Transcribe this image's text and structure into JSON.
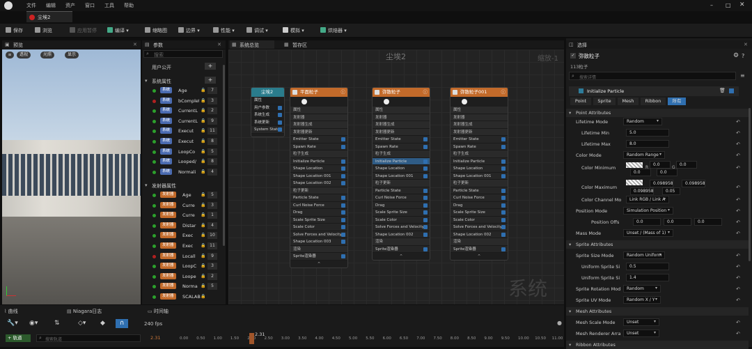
{
  "menu": [
    "文件",
    "编辑",
    "资产",
    "窗口",
    "工具",
    "帮助"
  ],
  "doc_tab": "尘埃2",
  "toolbar": {
    "save": "保存",
    "browse": "浏览",
    "apply": "应用暂停",
    "compile": "编译",
    "thumbnail": "缩略图",
    "bounds": "边界",
    "perf": "性能",
    "debug": "调试",
    "sim": "模拟",
    "baker": "烘焙器"
  },
  "preview": {
    "tab": "预览",
    "persp": "透视",
    "lit": "光照",
    "show": "显示"
  },
  "params": {
    "tab": "参数",
    "search": "搜索",
    "user_exposed": "用户公开",
    "system_attrs": "系统属性",
    "emitter_attrs": "发射器属性",
    "system_items": [
      {
        "badge": "系统",
        "name": "Age",
        "count": "7",
        "dot": "#2ca02c"
      },
      {
        "badge": "系统",
        "name": "bComplet",
        "count": "3",
        "dot": "#b02020"
      },
      {
        "badge": "系统",
        "name": "CurrentL",
        "count": "2",
        "dot": "#2ca02c"
      },
      {
        "badge": "系统",
        "name": "CurrentL",
        "count": "9",
        "dot": "#2ca02c"
      },
      {
        "badge": "系统",
        "name": "Execut",
        "count": "11",
        "dot": "#2ca02c"
      },
      {
        "badge": "系统",
        "name": "Execut",
        "count": "8",
        "dot": "#2ca02c"
      },
      {
        "badge": "系统",
        "name": "LoopCo",
        "count": "5",
        "dot": "#2ca02c"
      },
      {
        "badge": "系统",
        "name": "Looped/",
        "count": "8",
        "dot": "#2ca02c"
      },
      {
        "badge": "系统",
        "name": "Normali",
        "count": "4",
        "dot": "#2ca02c"
      }
    ],
    "emitter_items": [
      {
        "badge": "发射器",
        "name": "Age",
        "count": "5",
        "dot": "#2ca02c"
      },
      {
        "badge": "发射器",
        "name": "Curre",
        "count": "3",
        "dot": "#2ca02c"
      },
      {
        "badge": "发射器",
        "name": "Curre",
        "count": "1",
        "dot": "#2ca02c"
      },
      {
        "badge": "发射器",
        "name": "Distar",
        "count": "4",
        "dot": "#2ca02c"
      },
      {
        "badge": "发射器",
        "name": "Exec",
        "count": "10",
        "dot": "#2ca02c"
      },
      {
        "badge": "发射器",
        "name": "Exec",
        "count": "11",
        "dot": "#2ca02c"
      },
      {
        "badge": "发射器",
        "name": "Locall",
        "count": "9",
        "dot": "#b02020"
      },
      {
        "badge": "发射器",
        "name": "LoopC",
        "count": "3",
        "dot": "#2ca02c"
      },
      {
        "badge": "发射器",
        "name": "Loope",
        "count": "2",
        "dot": "#2ca02c"
      },
      {
        "badge": "发射器",
        "name": "Norma",
        "count": "5",
        "dot": "#2ca02c"
      },
      {
        "badge": "发射器",
        "name": "SCALAB",
        "count": "",
        "dot": "#2ca02c"
      }
    ]
  },
  "graph": {
    "tab1": "系统总览",
    "tab2": "暂存区",
    "title": "尘埃2",
    "watermark": "系统",
    "zoom": "缩放-1",
    "system_node": {
      "title": "尘埃2",
      "rows": [
        "属性",
        "用户参数",
        "系统生成",
        "系统更新",
        "System State"
      ]
    },
    "emitters": [
      {
        "title": "平面粒子",
        "rows": [
          "属性",
          "发射器",
          "发射器生成",
          "发射器更新",
          "Emitter State",
          "Spawn Rate",
          "粒子生成",
          "Initialize Particle",
          "Shape Location",
          "Shape Location 001",
          "Shape Location 002",
          "粒子更新",
          "Particle State",
          "Curl Noise Force",
          "Drag",
          "Scale Sprite Size",
          "Scale Color",
          "Solve Forces and Velocity",
          "Shape Location 003",
          "渲染",
          "Sprite渲染器"
        ]
      },
      {
        "title": "弥散粒子",
        "rows": [
          "属性",
          "发射器",
          "发射器生成",
          "发射器更新",
          "Emitter State",
          "Spawn Rate",
          "粒子生成",
          "Initialize Particle",
          "Shape Location",
          "Shape Location 001",
          "粒子更新",
          "Particle State",
          "Curl Noise Force",
          "Drag",
          "Scale Sprite Size",
          "Scale Color",
          "Solve Forces and Velocity",
          "Shape Location 002",
          "渲染",
          "Sprite渲染器"
        ]
      },
      {
        "title": "弥散粒子001",
        "rows": [
          "属性",
          "发射器",
          "发射器生成",
          "发射器更新",
          "Emitter State",
          "Spawn Rate",
          "粒子生成",
          "Initialize Particle",
          "Shape Location",
          "Shape Location 001",
          "粒子更新",
          "Particle State",
          "Curl Noise Force",
          "Drag",
          "Scale Sprite Size",
          "Scale Color",
          "Solve Forces and Velocity",
          "Shape Location 002",
          "渲染",
          "Sprite渲染器"
        ]
      }
    ]
  },
  "details": {
    "tab": "选择",
    "emitter": "弥散粒子",
    "subtitle": "113粒子",
    "search": "搜索详情",
    "module": "Initialize Particle",
    "filters": [
      "Point",
      "Sprite",
      "Mesh",
      "Ribbon",
      "所有"
    ],
    "sec_point": "Point Attributes",
    "lifetime_mode_label": "Lifetime Mode",
    "lifetime_mode": "Random",
    "lifetime_min_label": "Lifetime Min",
    "lifetime_min": "5.0",
    "lifetime_max_label": "Lifetime Max",
    "lifetime_max": "8.0",
    "color_mode_label": "Color Mode",
    "color_mode": "Random Range",
    "color_min_label": "Color Minimum",
    "cmin_r": "0.0",
    "cmin_g": "0.0",
    "cmin_b": "0.0",
    "cmin_a": "0.0",
    "color_max_label": "Color Maximum",
    "cmax_r": "0.098958",
    "cmax_g": "0.098958",
    "cmax_b": "0.098958",
    "cmax_a": "0.05",
    "channel_label": "Color Channel Mo",
    "channel": "Link RGB / Link A",
    "pos_mode_label": "Position Mode",
    "pos_mode": "Simulation Position",
    "pos_offset_label": "Position Offs",
    "px": "0.0",
    "py": "0.0",
    "pz": "0.0",
    "mass_label": "Mass Mode",
    "mass": "Unset / (Mass of 1)",
    "sec_sprite": "Sprite Attributes",
    "size_mode_label": "Sprite Size Mode",
    "size_mode": "Random Uniform",
    "usize_min_label": "Uniform Sprite Si",
    "usize_min": "0.5",
    "usize_max_label": "Uniform Sprite Si",
    "usize_max": "1.4",
    "rot_label": "Sprite Rotation Mod",
    "rot": "Random",
    "uv_label": "Sprite UV Mode",
    "uv": "Random X / Y",
    "sec_mesh": "Mesh Attributes",
    "mesh_scale_label": "Mesh Scale Mode",
    "mesh_scale": "Unset",
    "mesh_renderer_label": "Mesh Renderer Arra",
    "mesh_renderer": "Unset",
    "sec_ribbon": "Ribbon Attributes"
  },
  "bottom": {
    "tab_curves": "曲线",
    "tab_log": "Niagara日志",
    "tab_timeline": "时间轴",
    "fps": "240 fps",
    "add_track": "轨道",
    "search": "搜索轨道",
    "time": "2.31",
    "time_left": "2.31",
    "ticks": [
      "0.00",
      "0.50",
      "1.00",
      "1.50",
      "2.00",
      "2.50",
      "3.00",
      "3.50",
      "4.00",
      "4.50",
      "5.00",
      "5.50",
      "6.00",
      "6.50",
      "7.00",
      "7.50",
      "8.00",
      "8.50",
      "9.00",
      "9.50",
      "10.00",
      "10.50",
      "11.00"
    ]
  }
}
